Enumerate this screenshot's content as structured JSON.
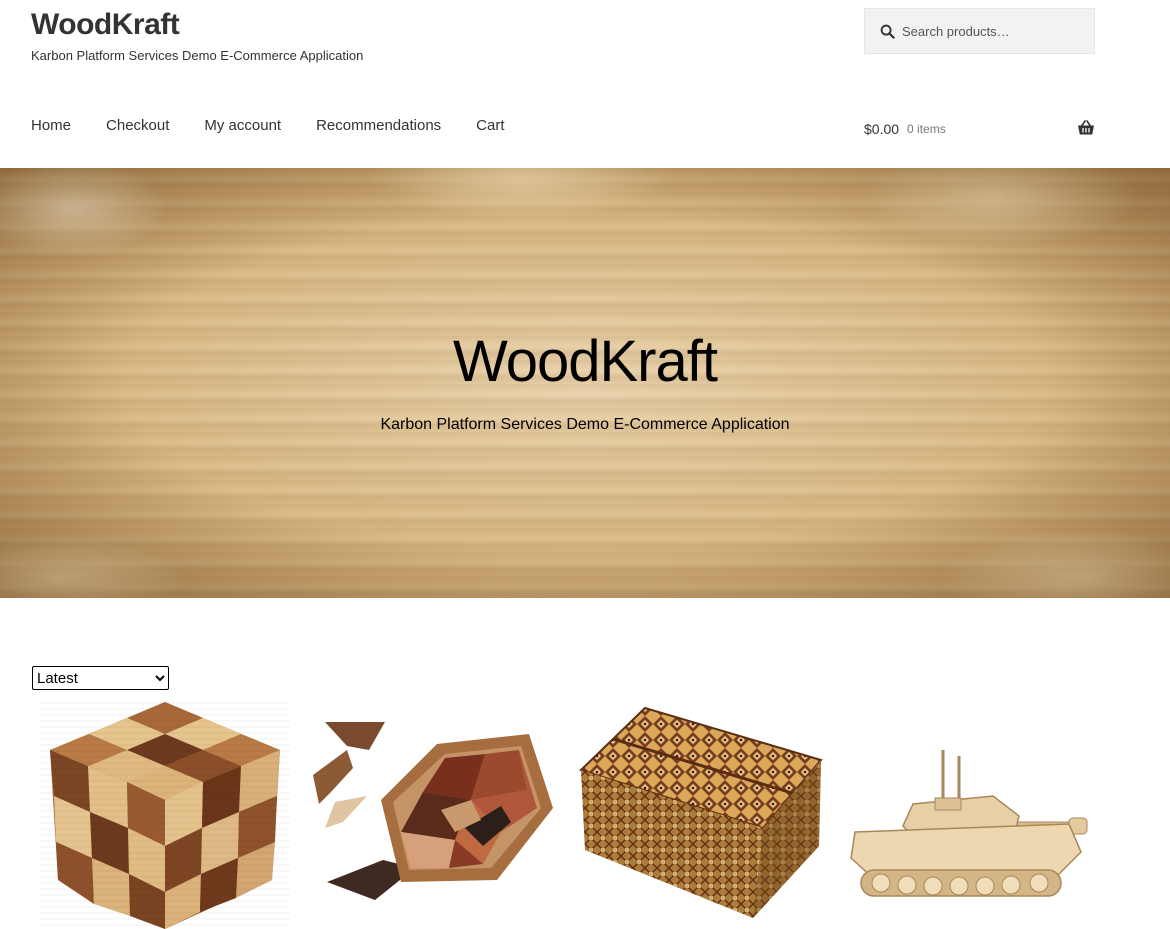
{
  "site": {
    "title": "WoodKraft",
    "tagline": "Karbon Platform Services Demo E-Commerce Application"
  },
  "search": {
    "placeholder": "Search products…",
    "icon": "search-icon"
  },
  "nav": {
    "items": [
      {
        "label": "Home"
      },
      {
        "label": "Checkout"
      },
      {
        "label": "My account"
      },
      {
        "label": "Recommendations"
      },
      {
        "label": "Cart"
      }
    ]
  },
  "cart": {
    "amount": "$0.00",
    "count": "0 items",
    "icon": "basket-icon"
  },
  "hero": {
    "title": "WoodKraft",
    "subtitle": "Karbon Platform Services Demo E-Commerce Application"
  },
  "sort": {
    "selected": "Latest",
    "options": [
      "Latest"
    ]
  },
  "products": [
    {
      "image": "wooden-cube-puzzle"
    },
    {
      "image": "hexagon-tangram-puzzle"
    },
    {
      "image": "japanese-puzzle-box"
    },
    {
      "image": "wooden-tank-model"
    }
  ],
  "colors": {
    "text": "#333333",
    "search_bg": "#f2f2f2",
    "hero_wood": "#d9b983"
  }
}
